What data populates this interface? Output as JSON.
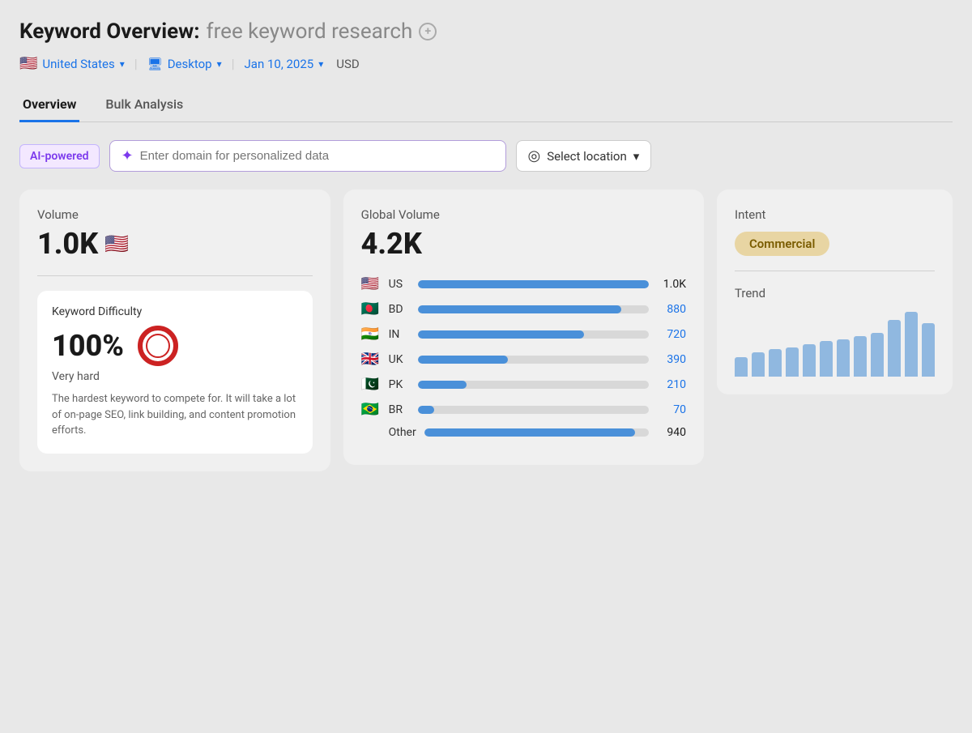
{
  "header": {
    "title_prefix": "Keyword Overview:",
    "title_query": "free keyword research",
    "country": "United States",
    "country_flag": "🇺🇸",
    "device": "Desktop",
    "date": "Jan 10, 2025",
    "currency": "USD"
  },
  "tabs": [
    {
      "label": "Overview",
      "active": true
    },
    {
      "label": "Bulk Analysis",
      "active": false
    }
  ],
  "ai_section": {
    "badge": "AI-powered",
    "placeholder": "Enter domain for personalized data",
    "location_label": "Select location"
  },
  "volume_card": {
    "label": "Volume",
    "value": "1.0K",
    "flag": "🇺🇸"
  },
  "keyword_difficulty": {
    "label": "Keyword Difficulty",
    "percent": "100%",
    "difficulty_label": "Very hard",
    "description": "The hardest keyword to compete for. It will take a lot of on-page SEO, link building, and content promotion efforts."
  },
  "global_volume": {
    "label": "Global Volume",
    "value": "4.2K",
    "countries": [
      {
        "flag": "🇺🇸",
        "code": "US",
        "count": "1.0K",
        "bar_pct": 100,
        "dark": true
      },
      {
        "flag": "🇧🇩",
        "code": "BD",
        "count": "880",
        "bar_pct": 88,
        "dark": false
      },
      {
        "flag": "🇮🇳",
        "code": "IN",
        "count": "720",
        "bar_pct": 72,
        "dark": false
      },
      {
        "flag": "🇬🇧",
        "code": "UK",
        "count": "390",
        "bar_pct": 39,
        "dark": false
      },
      {
        "flag": "🇵🇰",
        "code": "PK",
        "count": "210",
        "bar_pct": 21,
        "dark": false
      },
      {
        "flag": "🇧🇷",
        "code": "BR",
        "count": "70",
        "bar_pct": 7,
        "dark": false
      }
    ],
    "other_label": "Other",
    "other_count": "940",
    "other_bar_pct": 94
  },
  "intent_card": {
    "intent_label": "Intent",
    "commercial_badge": "Commercial",
    "trend_label": "Trend",
    "trend_bars": [
      30,
      35,
      38,
      40,
      42,
      45,
      50,
      55,
      60,
      75,
      80
    ]
  },
  "icons": {
    "add": "+",
    "chevron_down": "▾",
    "sparkle": "✦",
    "location": "◎",
    "desktop": "🖥"
  }
}
